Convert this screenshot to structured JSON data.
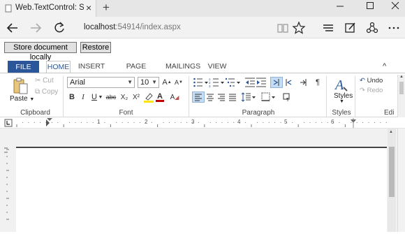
{
  "browser": {
    "tab_title": "Web.TextControl: Save d",
    "tab_close": "×",
    "new_tab": "+",
    "url_host": "localhost",
    "url_path": ":54914/index.aspx",
    "icons": [
      "back-icon",
      "forward-icon",
      "refresh-icon",
      "reading-view-icon",
      "favorite-star-icon",
      "hub-icon",
      "web-note-icon",
      "share-icon",
      "more-icon"
    ]
  },
  "page": {
    "store_label": "Store document locally",
    "restore_label": "Restore"
  },
  "ribbon": {
    "tabs": [
      "FILE",
      "HOME",
      "INSERT",
      "PAGE LAYOUT",
      "MAILINGS",
      "VIEW"
    ],
    "active_tab": "HOME",
    "collapse": "^",
    "clipboard": {
      "paste_label": "Paste",
      "cut_label": "Cut",
      "copy_label": "Copy",
      "group_label": "Clipboard"
    },
    "font": {
      "font_name": "Arial",
      "font_size": "10",
      "bold": "B",
      "italic": "I",
      "underline": "U",
      "strike": "abc",
      "subscript": "X₂",
      "superscript": "X²",
      "group_label": "Font"
    },
    "paragraph": {
      "group_label": "Paragraph",
      "pilcrow": "¶"
    },
    "styles": {
      "label": "Styles",
      "group_label": "Styles"
    },
    "editing": {
      "undo_label": "Undo",
      "redo_label": "Redo",
      "group_label": "Edi"
    }
  },
  "ruler": {
    "numbers": [
      "1",
      "2",
      "3",
      "4",
      "5",
      "6"
    ]
  },
  "colors": {
    "accent": "#2b579a",
    "highlight": "#c5dcf3"
  }
}
